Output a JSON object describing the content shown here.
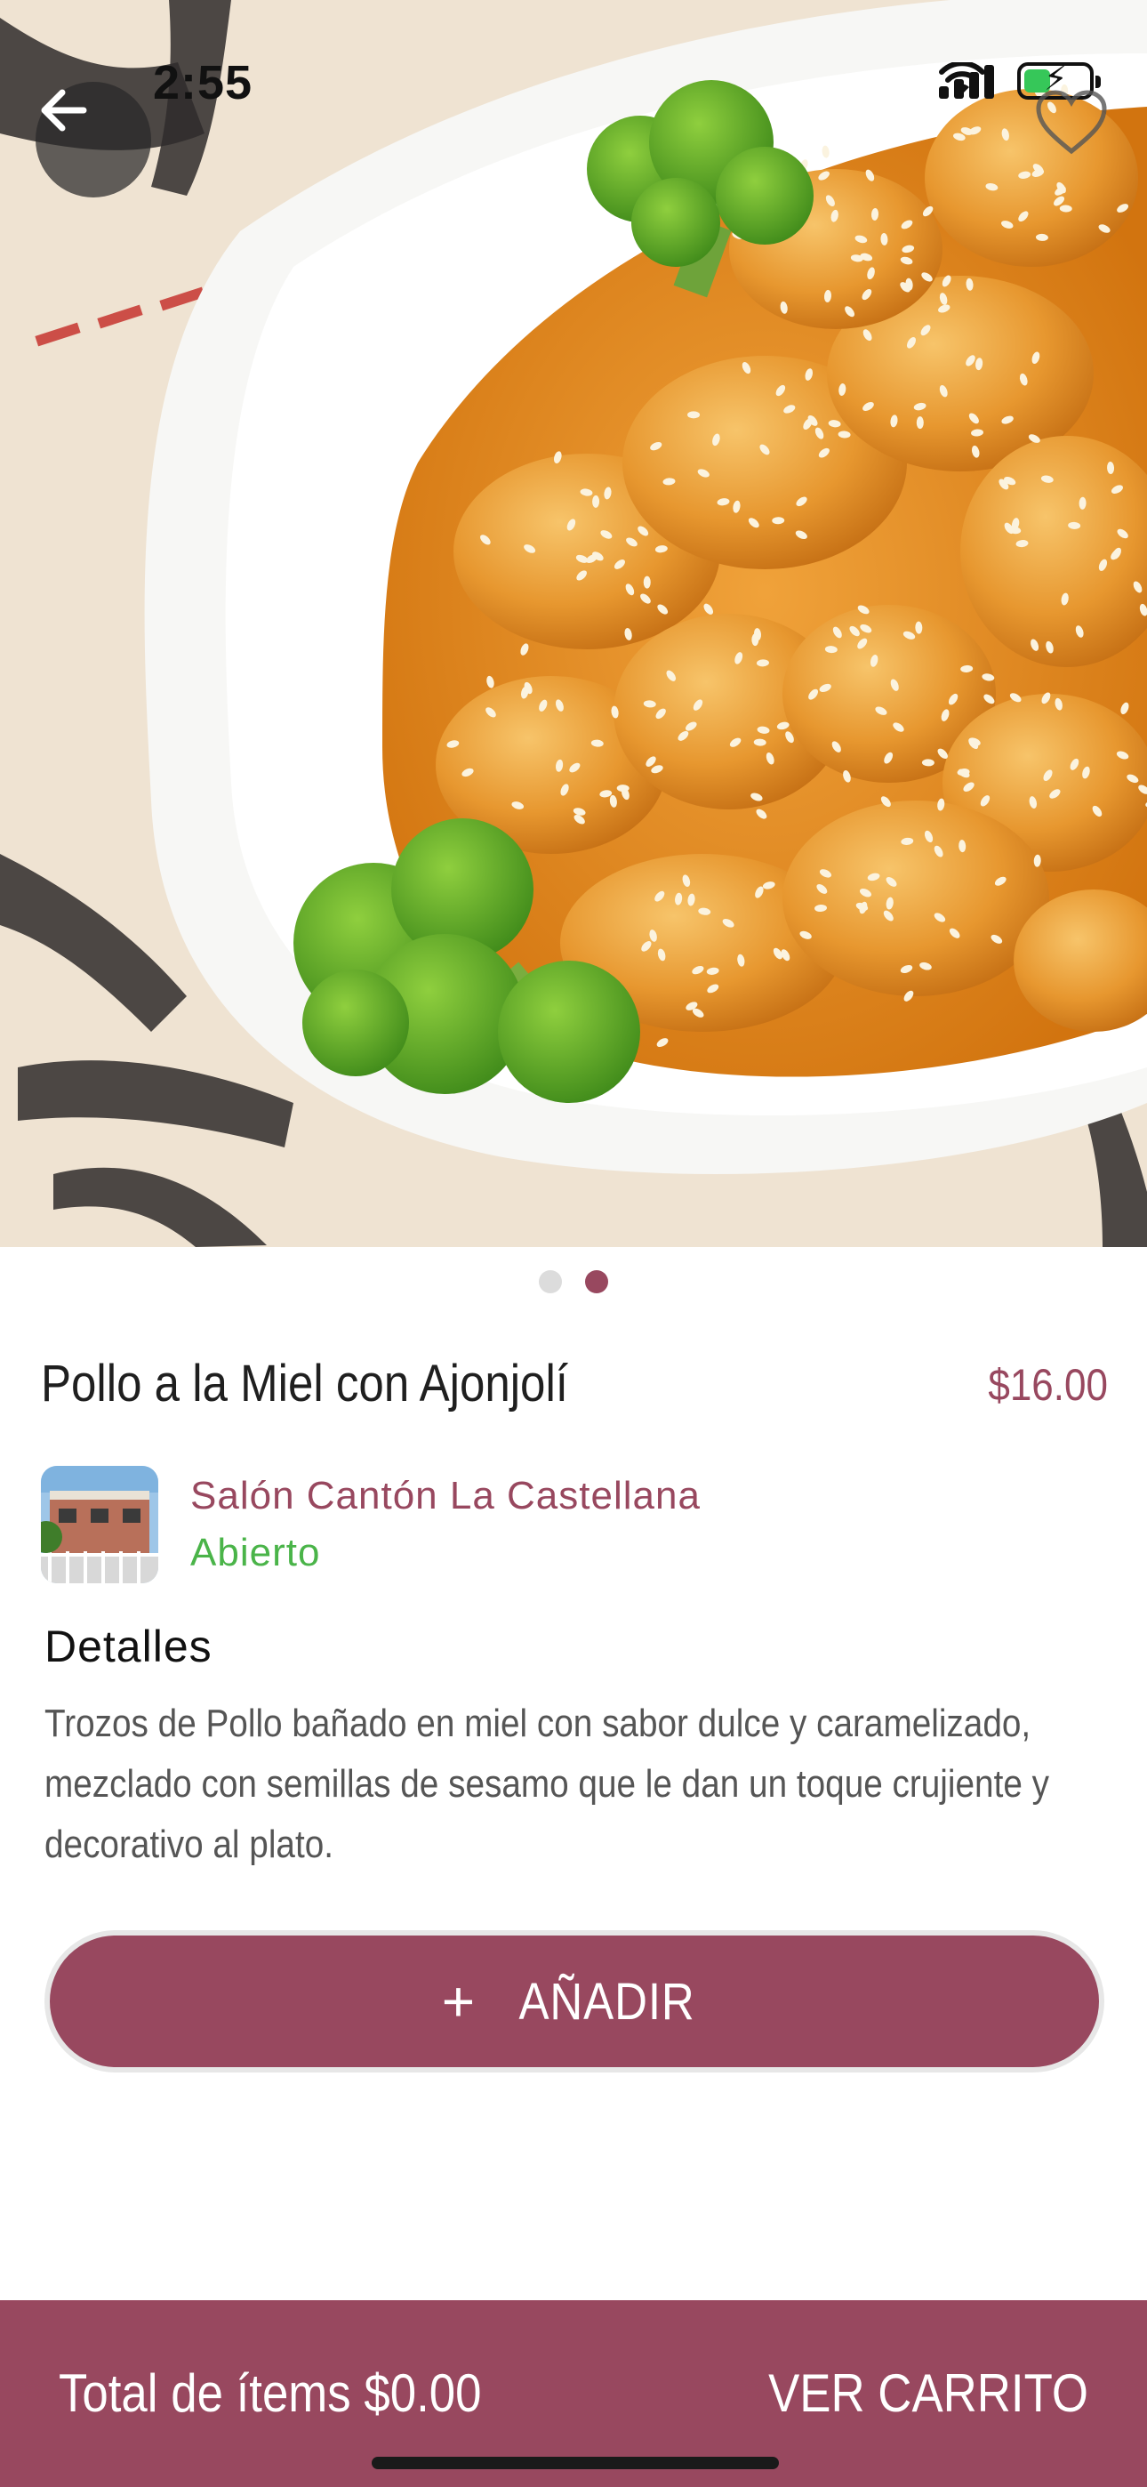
{
  "status_bar": {
    "time": "2:55",
    "battery_level": 0.42
  },
  "hero": {
    "image_count": 2,
    "active_image_index": 1,
    "back_icon": "arrow-left-icon",
    "favorite_icon": "heart-outline-icon"
  },
  "product": {
    "name": "Pollo a la Miel con Ajonjolí",
    "price": "$16.00"
  },
  "store": {
    "name": "Salón Cantón La Castellana",
    "status": "Abierto"
  },
  "details": {
    "title": "Detalles",
    "description": "Trozos de Pollo bañado en miel con sabor dulce y caramelizado, mezclado con semillas de sesamo que le dan un toque crujiente y decorativo al plato."
  },
  "add_button": {
    "icon": "+",
    "label": "AÑADIR"
  },
  "cart_bar": {
    "total_label": "Total de ítems $0.00",
    "view_cart_label": "VER CARRITO"
  },
  "colors": {
    "brand": "#98485f",
    "open_status": "#4ab449",
    "text_primary": "#1f1f1f",
    "text_secondary": "#555555"
  }
}
